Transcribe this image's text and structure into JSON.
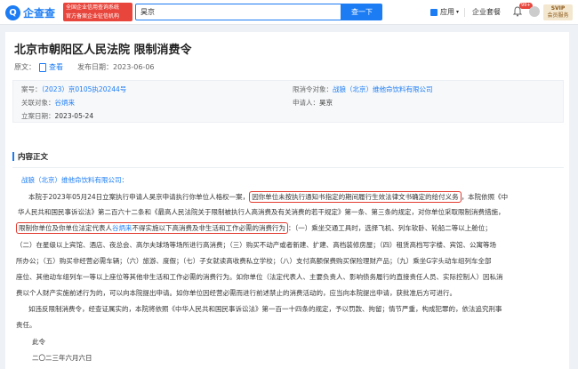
{
  "header": {
    "logo_mark": "Q",
    "logo_text": "企查查",
    "tagline_line1": "全国企业信用查询系统",
    "tagline_line2": "官方备案企业征信机构",
    "search_value": "昊京",
    "search_button": "查一下",
    "nav_app": "应用",
    "nav_kit": "企业套餐",
    "badge_count": "99+",
    "vip_line1": "SVIP",
    "vip_line2": "会员服务"
  },
  "page": {
    "title": "北京市朝阳区人民法院 限制消费令",
    "source_label": "原文：",
    "source_link": "查看",
    "publish_label": "发布日期：",
    "publish_date": "2023-06-06"
  },
  "info": {
    "case_no_label": "案号：",
    "case_no": "（2023）京0105执20244号",
    "restricted_label": "限消令对象：",
    "restricted": "战狼（北京）维他命饮料有限公司",
    "related_label": "关联对象：",
    "related": "谷炳来",
    "applicant_label": "申请人：",
    "applicant": "昊京",
    "filing_label": "立案日期：",
    "filing_date": "2023-05-24"
  },
  "content": {
    "section_title": "内容正文",
    "company": "战狼（北京）维他命饮料有限公司：",
    "p1_a": "本院于2023年05月24日立案执行申请人昊京申请执行你单位人格权一案，",
    "p1_hl": "因你单位未按执行通知书指定的期间履行生效法律文书确定的给付义务",
    "p1_b": "，本院依照《中",
    "p2": "华人民共和国民事诉讼法》第二百六十二条和《最高人民法院关于限制被执行人高消费及有关消费的若干规定》第一条、第三条的规定，对你单位采取限制消费措施，",
    "p3_hl_a": "限制你单位及你单位法定代表人",
    "p3_person": "谷炳来",
    "p3_hl_b": "不得实施以下高消费及非生活和工作必需的消费行为",
    "p3_b": "：（一）乘坐交通工具时，选择飞机、列车软卧、轮船二等以上舱位；",
    "p4": "（二）在星级以上宾馆、酒店、夜总会、高尔夫球场等场所进行高消费；（三）购买不动产或者新建、扩建、高档装修房屋；（四）租赁高档写字楼、宾馆、公寓等场",
    "p5": "所办公；（五）购买非经营必需车辆；（六）旅游、度假；（七）子女就读高收费私立学校；（八）支付高额保费购买保险理财产品；（九）乘坐G字头动车组列车全部",
    "p6": "座位、其他动车组列车一等以上座位等其他非生活和工作必需的消费行为。如你单位（法定代表人、主要负责人、影响债务履行的直接责任人员、实际控制人）因私消",
    "p7": "费以个人财产实施前述行为的，可以向本院提出申请。如你单位因经营必需而进行前述禁止的消费活动的，应当向本院提出申请，获批准后方可进行。",
    "p8": "如违反限制消费令，经查证属实的，本院将依照《中华人民共和国民事诉讼法》第一百一十四条的规定，予以罚款、拘留；情节严重，构成犯罪的，依法追究刑事",
    "p9": "责任。",
    "p10": "此令",
    "p11": "二〇二三年六月六日"
  },
  "colors": {
    "brand": "#1c7cf4",
    "highlight_border": "#e23b30"
  }
}
